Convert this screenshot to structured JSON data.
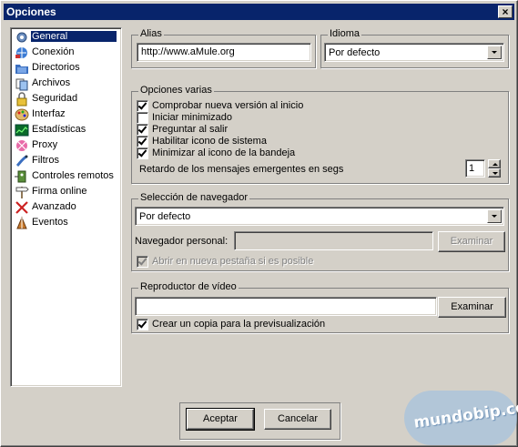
{
  "window": {
    "title": "Opciones",
    "close": "×"
  },
  "sidebar": {
    "items": [
      {
        "label": "General",
        "icon": "gear-icon",
        "selected": true
      },
      {
        "label": "Conexión",
        "icon": "network-icon"
      },
      {
        "label": "Directorios",
        "icon": "folder-icon"
      },
      {
        "label": "Archivos",
        "icon": "files-icon"
      },
      {
        "label": "Seguridad",
        "icon": "lock-icon"
      },
      {
        "label": "Interfaz",
        "icon": "palette-icon"
      },
      {
        "label": "Estadísticas",
        "icon": "chart-icon"
      },
      {
        "label": "Proxy",
        "icon": "proxy-icon"
      },
      {
        "label": "Filtros",
        "icon": "filter-icon"
      },
      {
        "label": "Controles remotos",
        "icon": "remote-icon"
      },
      {
        "label": "Firma online",
        "icon": "signpost-icon"
      },
      {
        "label": "Avanzado",
        "icon": "tools-icon"
      },
      {
        "label": "Eventos",
        "icon": "events-icon"
      }
    ]
  },
  "alias": {
    "legend": "Alias",
    "value": "http://www.aMule.org"
  },
  "idioma": {
    "legend": "Idioma",
    "value": "Por defecto"
  },
  "opciones": {
    "legend": "Opciones varias",
    "checks": [
      {
        "label": "Comprobar nueva versión al inicio",
        "checked": true
      },
      {
        "label": "Iniciar minimizado",
        "checked": false
      },
      {
        "label": "Preguntar al salir",
        "checked": true
      },
      {
        "label": "Habilitar icono de sistema",
        "checked": true
      },
      {
        "label": "Minimizar al icono de la bandeja",
        "checked": true
      }
    ],
    "delay_label": "Retardo de los mensajes emergentes en segs",
    "delay_value": "1"
  },
  "navegador": {
    "legend": "Selección de navegador",
    "value": "Por defecto",
    "personal_label": "Navegador personal:",
    "personal_value": "",
    "examinar": "Examinar",
    "new_tab_label": "Abrir en nueva pestaña si es posible",
    "new_tab_checked": true
  },
  "video": {
    "legend": "Reproductor de vídeo",
    "value": "",
    "examinar": "Examinar",
    "preview_label": "Crear un copia para la previsualización",
    "preview_checked": true
  },
  "footer": {
    "accept": "Aceptar",
    "cancel": "Cancelar"
  },
  "watermark": "mundobip.com"
}
